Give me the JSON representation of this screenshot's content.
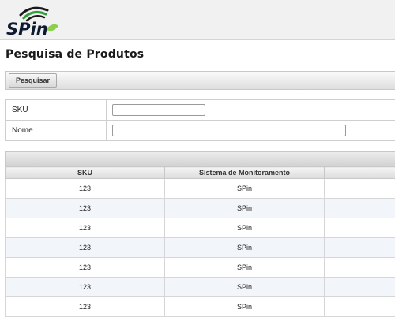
{
  "logo": {
    "text": "SPin",
    "colors": {
      "text": "#0d1a30",
      "green": "#2e9e3a",
      "leaf": "#8ccf4a"
    }
  },
  "page": {
    "title": "Pesquisa de Produtos"
  },
  "toolbar": {
    "search_label": "Pesquisar"
  },
  "form": {
    "sku_label": "SKU",
    "sku_value": "",
    "name_label": "Nome",
    "name_value": ""
  },
  "table": {
    "columns": [
      "SKU",
      "Sistema de Monitoramento",
      ""
    ],
    "rows": [
      [
        "123",
        "SPin",
        ""
      ],
      [
        "123",
        "SPin",
        ""
      ],
      [
        "123",
        "SPin",
        ""
      ],
      [
        "123",
        "SPin",
        ""
      ],
      [
        "123",
        "SPin",
        ""
      ],
      [
        "123",
        "SPin",
        ""
      ],
      [
        "123",
        "SPin",
        ""
      ]
    ]
  }
}
